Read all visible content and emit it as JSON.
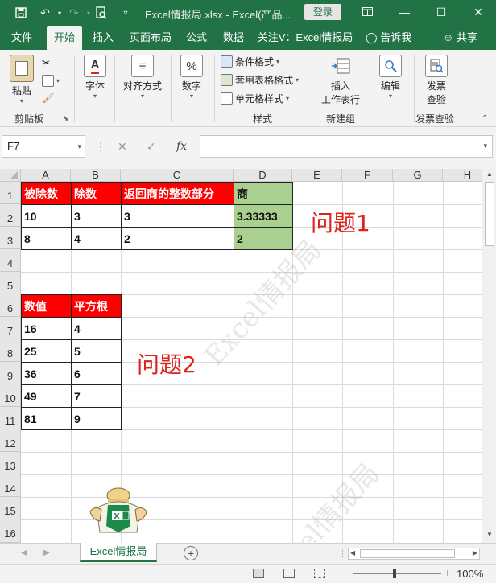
{
  "titlebar": {
    "title": "Excel情报局.xlsx - Excel(产品...",
    "login": "登录",
    "icons": [
      "save-icon",
      "undo-icon",
      "redo-icon",
      "print-preview-icon",
      "customize-icon"
    ]
  },
  "tabs": [
    "文件",
    "开始",
    "插入",
    "页面布局",
    "公式",
    "数据",
    "关注V：Excel情报局",
    "告诉我",
    "共享"
  ],
  "ribbon": {
    "clipboard": {
      "paste": "粘贴",
      "label": "剪贴板"
    },
    "font": {
      "label": "字体"
    },
    "align": {
      "label": "对齐方式"
    },
    "number": {
      "label": "数字"
    },
    "styles": {
      "cond": "条件格式",
      "table": "套用表格格式",
      "cell": "单元格样式",
      "label": "样式"
    },
    "insert": {
      "label1": "插入",
      "label2": "工作表行",
      "group": "新建组"
    },
    "edit": {
      "label": "编辑"
    },
    "invoice": {
      "label1": "发票",
      "label2": "查验",
      "group": "发票查验"
    }
  },
  "formula": {
    "namebox": "F7",
    "fx": "fx",
    "value": ""
  },
  "columns": [
    "A",
    "B",
    "C",
    "D",
    "E",
    "F",
    "G",
    "H"
  ],
  "rows": [
    "1",
    "2",
    "3",
    "4",
    "5",
    "6",
    "7",
    "8",
    "9",
    "10",
    "11",
    "12",
    "13",
    "14",
    "15",
    "16"
  ],
  "table1": {
    "headers": [
      "被除数",
      "除数",
      "返回商的整数部分",
      "商"
    ],
    "rows": [
      [
        "10",
        "3",
        "3",
        "3.33333"
      ],
      [
        "8",
        "4",
        "2",
        "2"
      ]
    ]
  },
  "table2": {
    "headers": [
      "数值",
      "平方根"
    ],
    "rows": [
      [
        "16",
        "4"
      ],
      [
        "25",
        "5"
      ],
      [
        "36",
        "6"
      ],
      [
        "49",
        "7"
      ],
      [
        "81",
        "9"
      ]
    ]
  },
  "annotations": {
    "q1": "问题1",
    "q2": "问题2"
  },
  "watermark": "Excel情报局",
  "sheet_tab": "Excel情报局",
  "zoom": "100%",
  "colors": {
    "brand": "#217346",
    "header_red": "#fe0000",
    "green": "#a9d08e",
    "annotation": "#e0201b"
  }
}
